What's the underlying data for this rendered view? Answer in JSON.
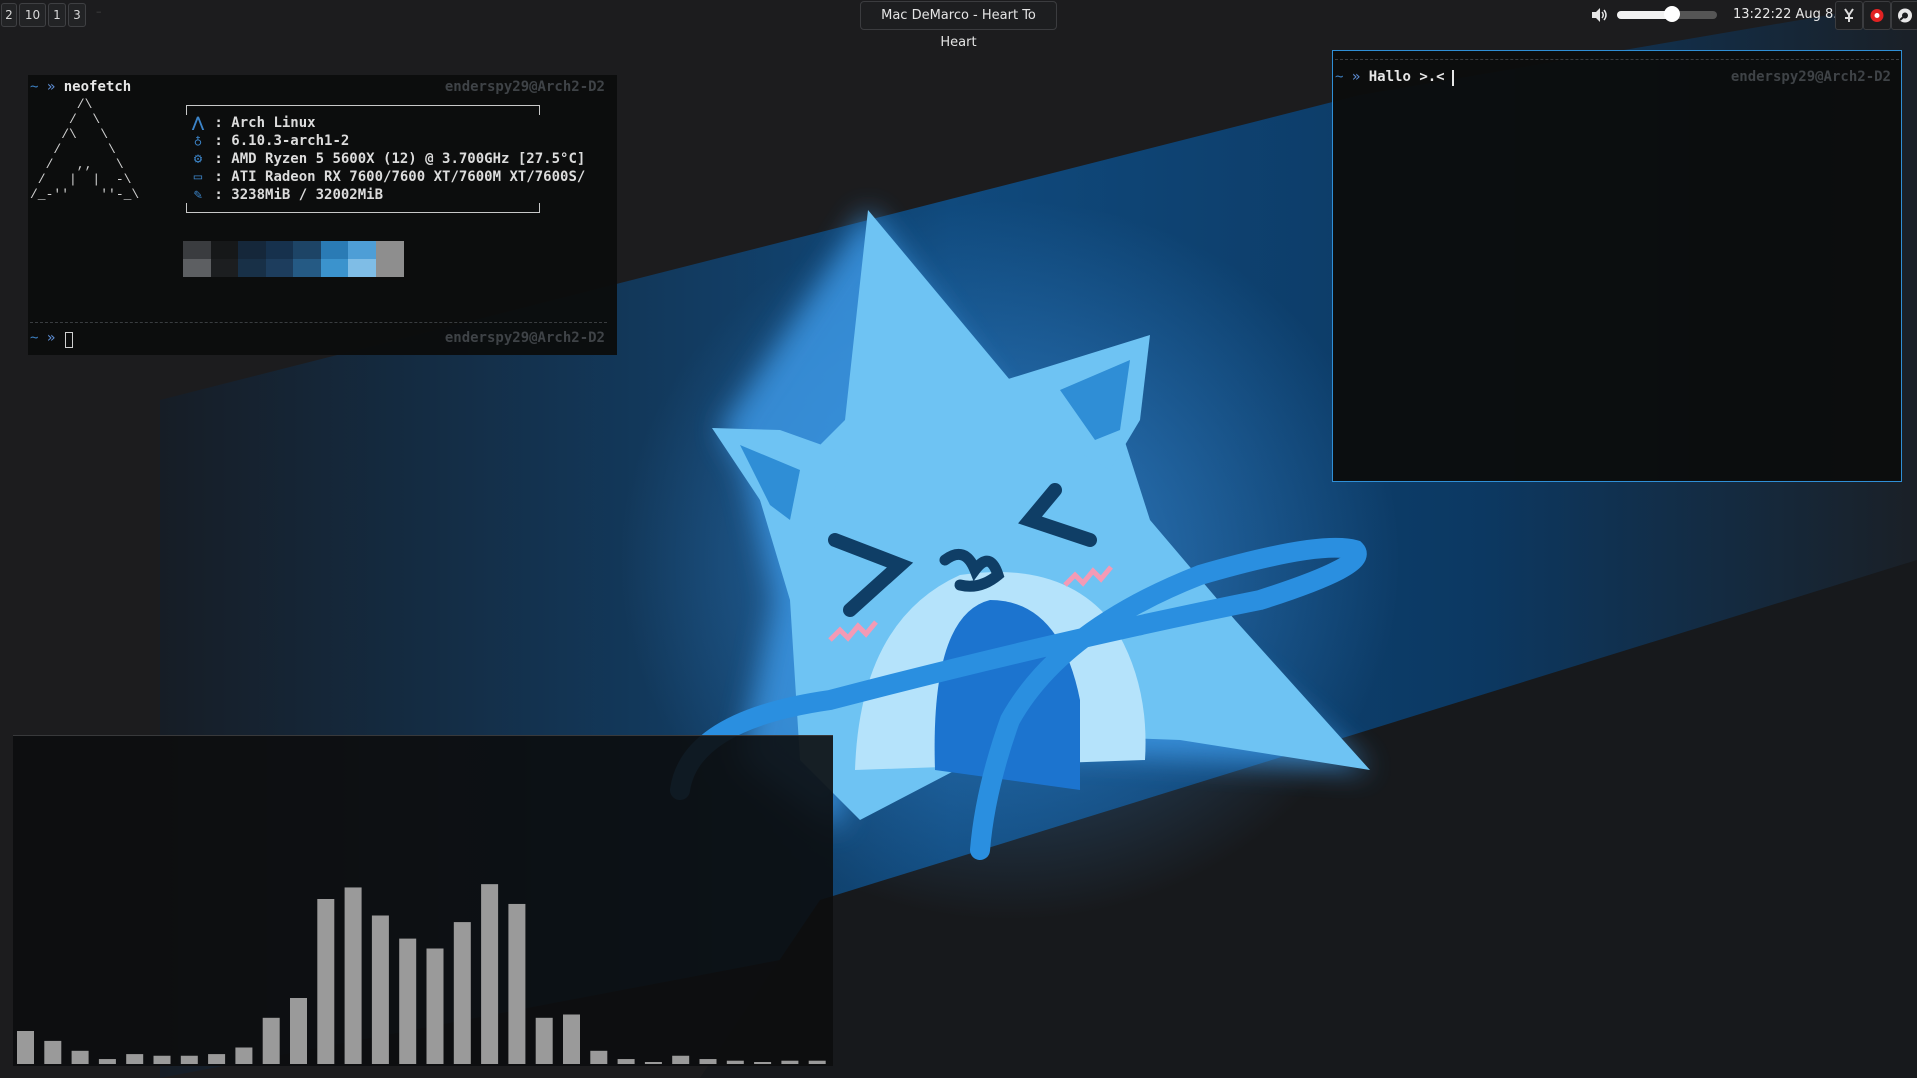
{
  "topbar": {
    "workspaces": [
      "2",
      "10",
      "1",
      "3"
    ],
    "window_title": "Mac DeMarco - Heart To Heart",
    "volume_fraction": 0.55,
    "clock": "13:22:22 Aug  8."
  },
  "neofetch_terminal": {
    "prompt_tilde": "~",
    "prompt_arrow": "»",
    "command": "neofetch",
    "host": "enderspy29@Arch2-D2",
    "ascii_logo": "      /\\\n     /  \\\n    /\\   \\\n   /      \\\n  /   ,,   \\\n /   |  |  -\\\n/_-''    ''-_\\",
    "info": [
      {
        "icon": "arch-icon",
        "glyph": "⋀",
        "text": "Arch Linux"
      },
      {
        "icon": "linux-icon",
        "glyph": "♁",
        "text": "6.10.3-arch1-2"
      },
      {
        "icon": "cpu-icon",
        "glyph": "⚙",
        "text": "AMD Ryzen 5 5600X (12) @ 3.700GHz [27.5°C]"
      },
      {
        "icon": "monitor-icon",
        "glyph": "▭",
        "text": "ATI Radeon RX 7600/7600 XT/7600M XT/7600S/"
      },
      {
        "icon": "memory-icon",
        "glyph": "✎",
        "text": "3238MiB / 32002MiB"
      }
    ],
    "colors_top": [
      "#3a3c3f",
      "#161819",
      "#15273a",
      "#16314d",
      "#1d4466",
      "#2a7bb5",
      "#4e9ed6",
      "#8e8e8e"
    ],
    "colors_bottom": [
      "#5d5f62",
      "#1c1e20",
      "#183047",
      "#1d3d5d",
      "#255a84",
      "#3b93cd",
      "#7fbde6",
      "#8e8e8e"
    ],
    "second_prompt_host": "enderspy29@Arch2-D2"
  },
  "hallo_terminal": {
    "prompt_tilde": "~",
    "prompt_arrow": "»",
    "command": "Hallo >.<",
    "host": "enderspy29@Arch2-D2"
  },
  "visualizer": {
    "bars": [
      0.1,
      0.07,
      0.04,
      0.015,
      0.03,
      0.025,
      0.025,
      0.03,
      0.05,
      0.14,
      0.2,
      0.5,
      0.535,
      0.45,
      0.38,
      0.35,
      0.43,
      0.545,
      0.485,
      0.14,
      0.15,
      0.04,
      0.015,
      0.005,
      0.025,
      0.015,
      0.01,
      0.005,
      0.01,
      0.01
    ]
  },
  "colors": {
    "accent_blue": "#3c84c8",
    "active_border": "#2f8fd6",
    "bar_gray": "#9a9a9a",
    "mascot_blue": "#6ec3f3"
  }
}
